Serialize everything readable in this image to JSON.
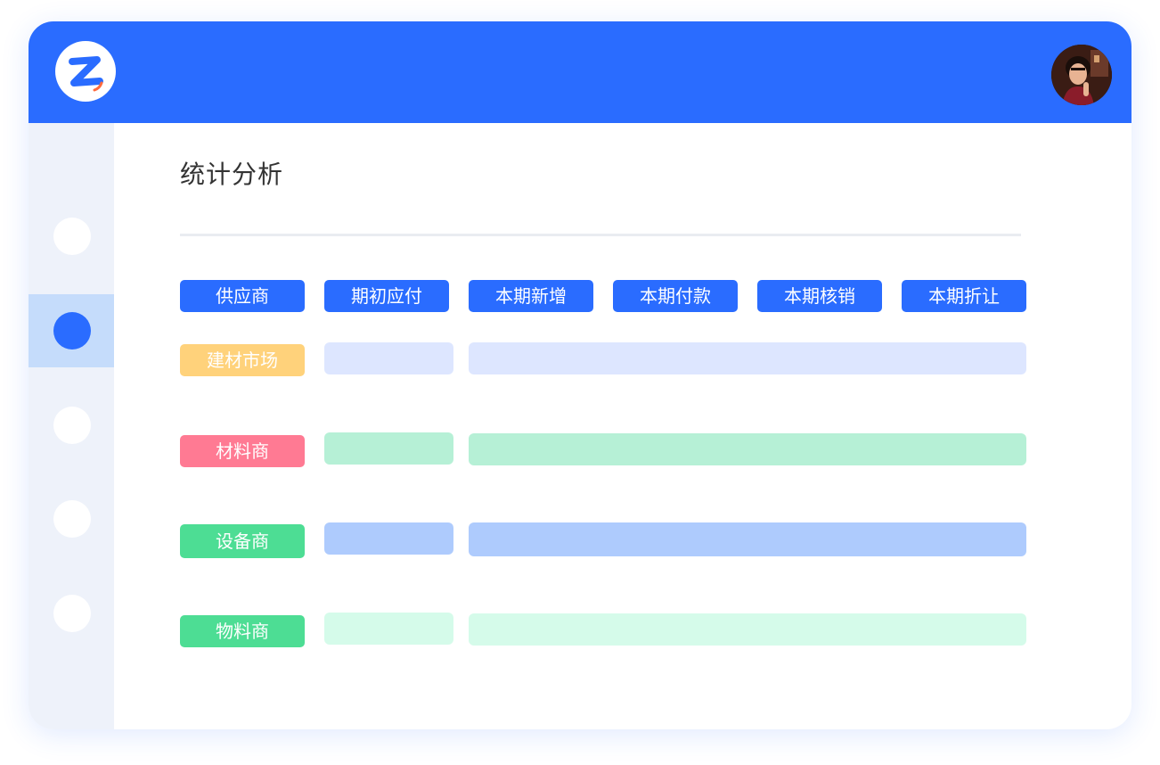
{
  "header": {
    "logo_icon": "brand-z-logo",
    "avatar_icon": "user-avatar-photo",
    "accent_color": "#2a6cff"
  },
  "sidebar": {
    "items": [
      {
        "icon": "nav-dot",
        "active": false
      },
      {
        "icon": "nav-dot",
        "active": true
      },
      {
        "icon": "nav-dot",
        "active": false
      },
      {
        "icon": "nav-dot",
        "active": false
      },
      {
        "icon": "nav-dot",
        "active": false
      }
    ]
  },
  "main": {
    "title": "统计分析",
    "columns": [
      "供应商",
      "期初应付",
      "本期新增",
      "本期付款",
      "本期核销",
      "本期折让"
    ],
    "rows": [
      {
        "label": "建材市场",
        "label_color": "#ffd27b",
        "bar_color": "#dde6ff"
      },
      {
        "label": "材料商",
        "label_color": "#ff7a93",
        "bar_color": "#b6f0d6"
      },
      {
        "label": "设备商",
        "label_color": "#4ddd94",
        "bar_color": "#aecbfd"
      },
      {
        "label": "物料商",
        "label_color": "#4ddd94",
        "bar_color": "#d5fbea"
      }
    ]
  }
}
